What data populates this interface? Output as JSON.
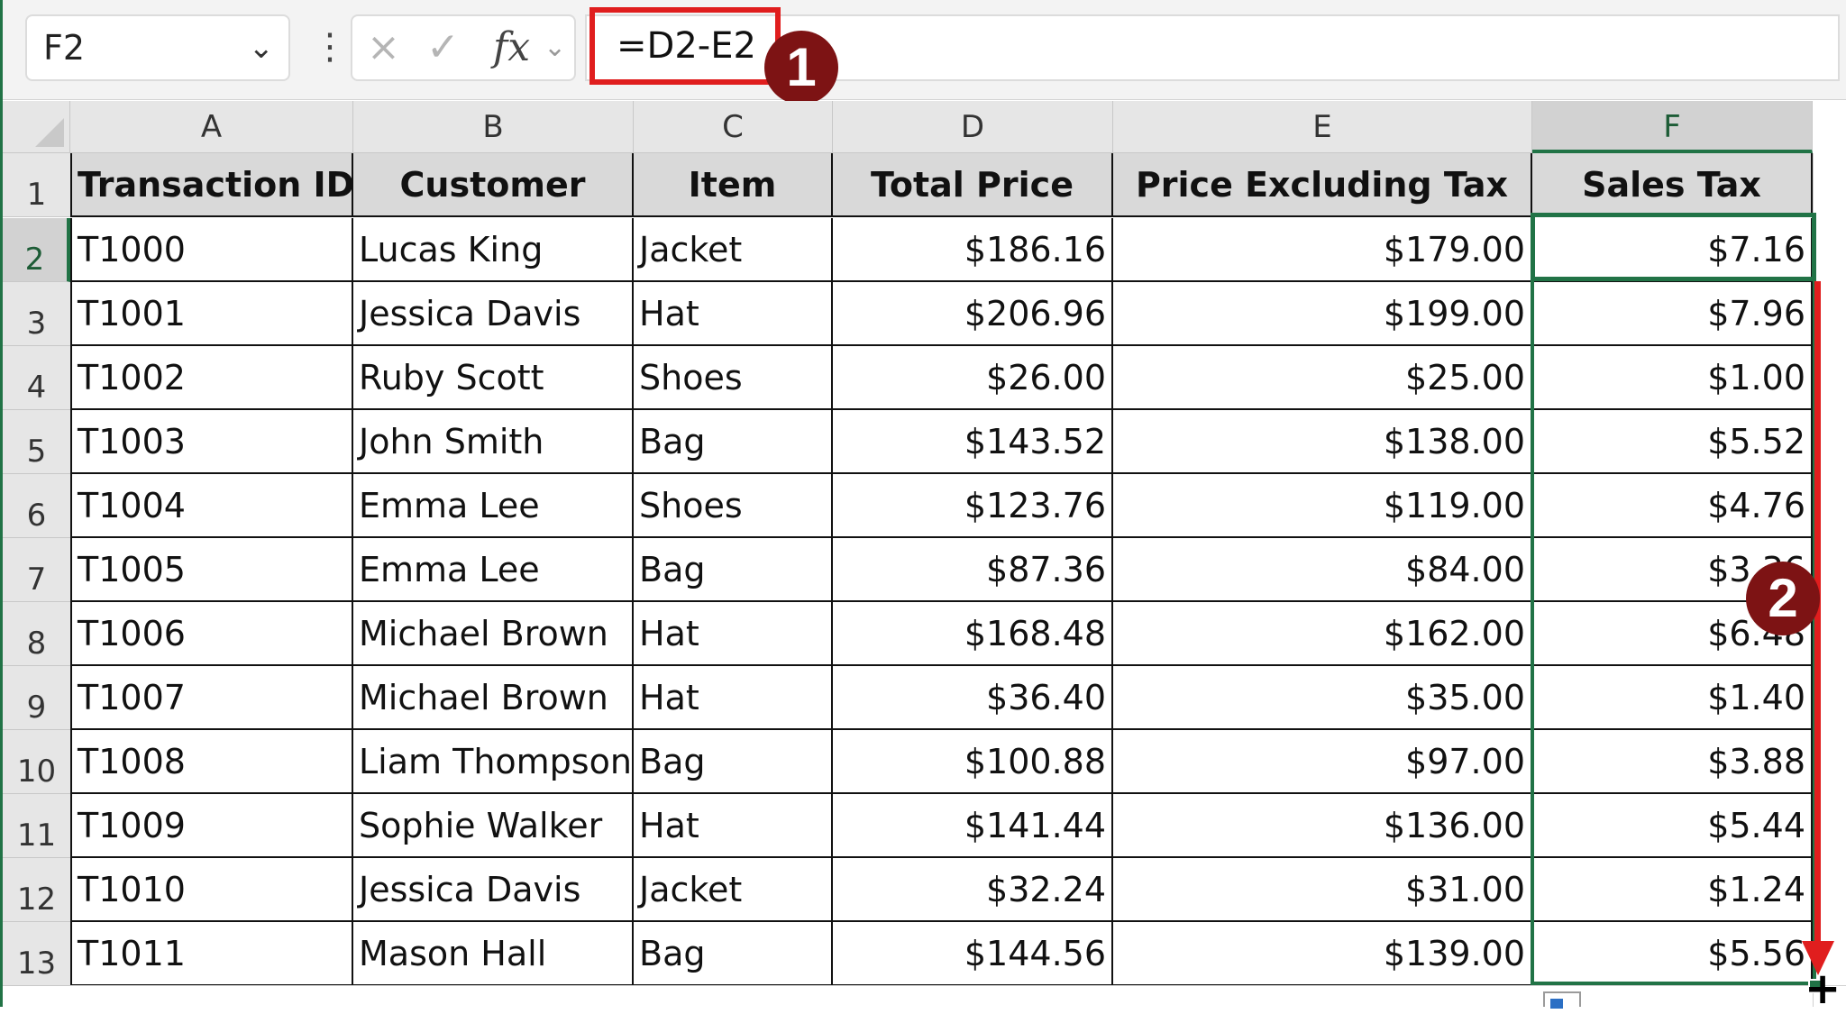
{
  "name_box": {
    "value": "F2"
  },
  "formula_bar": {
    "cancel_icon": "×",
    "enter_icon": "✓",
    "fx_label": "fx",
    "formula": "=D2-E2"
  },
  "annotations": {
    "badge1": "1",
    "badge2": "2"
  },
  "columns": [
    "A",
    "B",
    "C",
    "D",
    "E",
    "F"
  ],
  "row_numbers": [
    "1",
    "2",
    "3",
    "4",
    "5",
    "6",
    "7",
    "8",
    "9",
    "10",
    "11",
    "12",
    "13"
  ],
  "headers": [
    "Transaction ID",
    "Customer",
    "Item",
    "Total Price",
    "Price Excluding Tax",
    "Sales Tax"
  ],
  "rows": [
    [
      "T1000",
      "Lucas King",
      "Jacket",
      "$186.16",
      "$179.00",
      "$7.16"
    ],
    [
      "T1001",
      "Jessica Davis",
      "Hat",
      "$206.96",
      "$199.00",
      "$7.96"
    ],
    [
      "T1002",
      "Ruby Scott",
      "Shoes",
      "$26.00",
      "$25.00",
      "$1.00"
    ],
    [
      "T1003",
      "John Smith",
      "Bag",
      "$143.52",
      "$138.00",
      "$5.52"
    ],
    [
      "T1004",
      "Emma Lee",
      "Shoes",
      "$123.76",
      "$119.00",
      "$4.76"
    ],
    [
      "T1005",
      "Emma Lee",
      "Bag",
      "$87.36",
      "$84.00",
      "$3.36"
    ],
    [
      "T1006",
      "Michael Brown",
      "Hat",
      "$168.48",
      "$162.00",
      "$6.48"
    ],
    [
      "T1007",
      "Michael Brown",
      "Hat",
      "$36.40",
      "$35.00",
      "$1.40"
    ],
    [
      "T1008",
      "Liam Thompson",
      "Bag",
      "$100.88",
      "$97.00",
      "$3.88"
    ],
    [
      "T1009",
      "Sophie Walker",
      "Hat",
      "$141.44",
      "$136.00",
      "$5.44"
    ],
    [
      "T1010",
      "Jessica Davis",
      "Jacket",
      "$32.24",
      "$31.00",
      "$1.24"
    ],
    [
      "T1011",
      "Mason Hall",
      "Bag",
      "$144.56",
      "$139.00",
      "$5.56"
    ]
  ],
  "colors": {
    "selection": "#217346",
    "annotation_red": "#e01e1e",
    "badge": "#7d1314"
  }
}
